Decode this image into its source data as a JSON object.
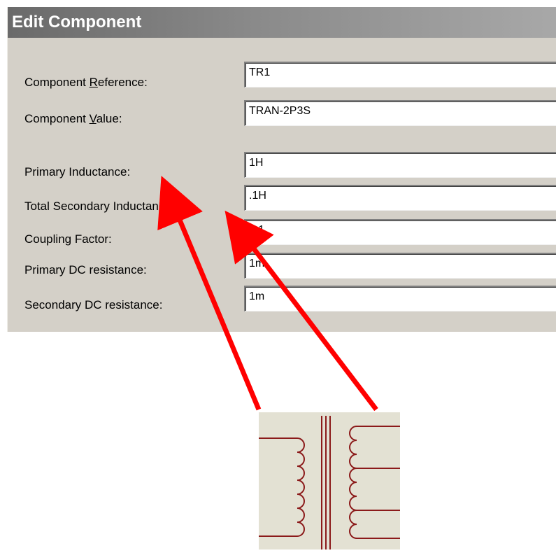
{
  "dialog": {
    "title": "Edit Component",
    "fields": [
      {
        "label_pre": "Component ",
        "label_ul": "R",
        "label_post": "eference:",
        "value": "TR1"
      },
      {
        "label_pre": "Component ",
        "label_ul": "V",
        "label_post": "alue:",
        "value": "TRAN-2P3S"
      },
      {
        "label_pre": "Primary Inductance:",
        "label_ul": "",
        "label_post": "",
        "value": "1H"
      },
      {
        "label_pre": "Total Secondary Inductance:",
        "label_ul": "",
        "label_post": "",
        "value": ".1H"
      },
      {
        "label_pre": "Coupling Factor:",
        "label_ul": "",
        "label_post": "",
        "value": "0.1"
      },
      {
        "label_pre": "Primary DC resistance:",
        "label_ul": "",
        "label_post": "",
        "value": "1m"
      },
      {
        "label_pre": "Secondary DC resistance:",
        "label_ul": "",
        "label_post": "",
        "value": "1m"
      }
    ]
  },
  "colors": {
    "arrow": "#ff0000",
    "winding": "#8b1a1a",
    "dialog_bg": "#d4d0c8",
    "symbol_bg": "#e3e1d3"
  },
  "symbol": {
    "icon": "transformer-icon"
  }
}
